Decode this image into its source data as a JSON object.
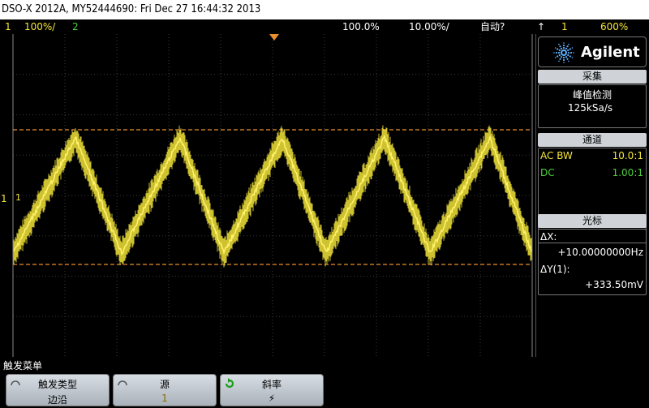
{
  "title_bar": "DSO-X 2012A, MY52444690: Fri Dec 27 16:44:32 2013",
  "status": {
    "ch1_num": "1",
    "ch1_scale": "100%/",
    "ch2_num": "2",
    "trigger_pos": "100.0%",
    "timebase": "10.00%/",
    "auto": "自动?",
    "trig_ch": "1",
    "trig_level": "600%"
  },
  "agilent": {
    "brand": "Agilent"
  },
  "acquire": {
    "header": "采集",
    "mode": "峰值检测",
    "rate": "125kSa/s"
  },
  "channels": {
    "header": "通道",
    "ch1_coupling": "AC BW",
    "ch1_probe": "10.0:1",
    "ch2_coupling": "DC",
    "ch2_probe": "1.00:1"
  },
  "cursor": {
    "header": "光标",
    "dx_label": "ΔX:",
    "dx_value": "+10.00000000Hz",
    "dy_label": "ΔY(1):",
    "dy_value": "+333.50mV"
  },
  "ground_marker": "1",
  "menu_title": "触发菜单",
  "softkeys": [
    {
      "label": "触发类型",
      "value": "边沿"
    },
    {
      "label": "源",
      "value": "1"
    },
    {
      "label": "斜率",
      "value": "⚡"
    }
  ],
  "colors": {
    "ch1": "#f3e43a",
    "ch2": "#4bd13a",
    "cursor": "#e8902e"
  }
}
